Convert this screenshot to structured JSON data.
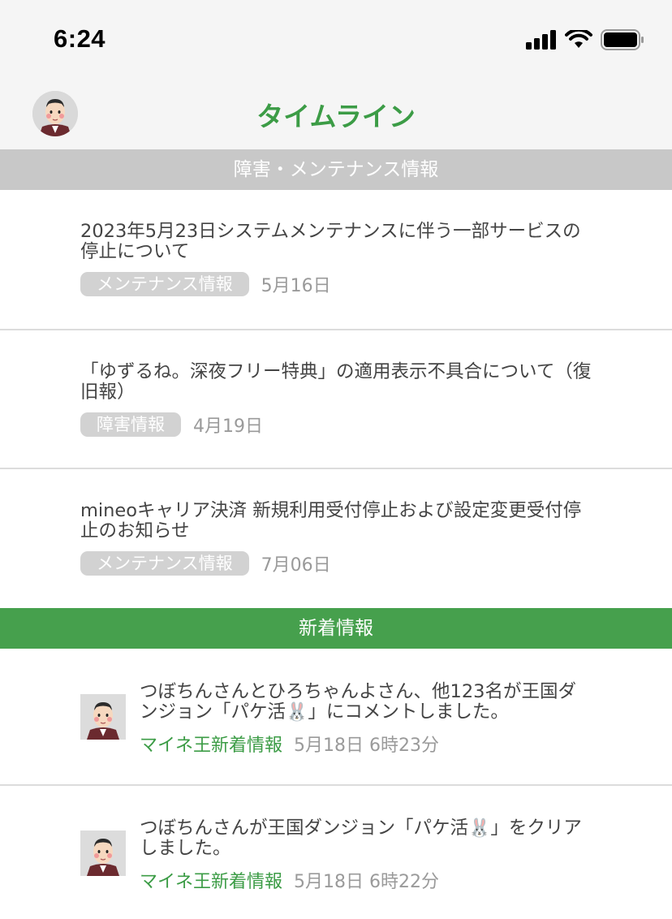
{
  "status_bar": {
    "time": "6:24"
  },
  "nav": {
    "title": "タイムライン"
  },
  "maintenance_section": {
    "header": "障害・メンテナンス情報",
    "items": [
      {
        "title": "2023年5月23日システムメンテナンスに伴う一部サービスの停止について",
        "tag": "メンテナンス情報",
        "date": "5月16日"
      },
      {
        "title": "「ゆずるね。深夜フリー特典」の適用表示不具合について（復旧報）",
        "tag": "障害情報",
        "date": "4月19日"
      },
      {
        "title": "mineoキャリア決済 新規利用受付停止および設定変更受付停止のお知らせ",
        "tag": "メンテナンス情報",
        "date": "7月06日"
      }
    ]
  },
  "news_section": {
    "header": "新着情報",
    "items": [
      {
        "title_before": "つぼちんさんとひろちゃんよさん、他123名が王国ダンジョン「パケ活",
        "title_after": "」にコメントしました。",
        "source": "マイネ王新着情報",
        "date": "5月18日 6時23分"
      },
      {
        "title_before": "つぼちんさんが王国ダンジョン「パケ活",
        "title_after": "」をクリアしました。",
        "source": "マイネ王新着情報",
        "date": "5月18日 6時22分"
      }
    ]
  },
  "colors": {
    "brand_green": "#3c9c46",
    "section_gray": "#c8c8c8",
    "section_green": "#46a04d",
    "tag_gray": "#d2d2d2"
  },
  "icons": [
    "signal-icon",
    "wifi-icon",
    "battery-icon",
    "avatar",
    "rabbit-emoji-icon"
  ]
}
